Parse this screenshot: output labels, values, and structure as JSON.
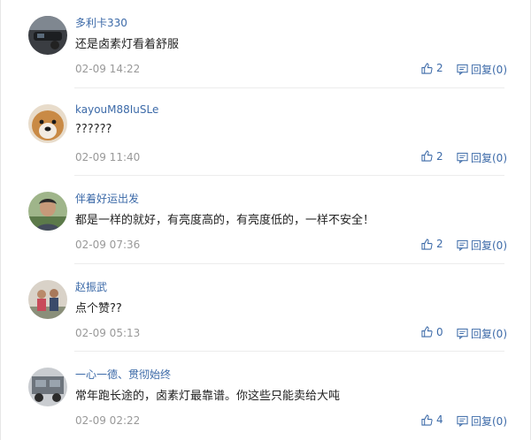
{
  "comments": [
    {
      "user": "多利卡330",
      "text": "还是卤素灯看着舒服",
      "time": "02-09 14:22",
      "likes": "2",
      "reply": "回复(0)",
      "avatar": "car-interior-avatar"
    },
    {
      "user": "kayouM88IuSLe",
      "text": "??????",
      "time": "02-09 11:40",
      "likes": "2",
      "reply": "回复(0)",
      "avatar": "dog-avatar"
    },
    {
      "user": "伴着好运出发",
      "text": "都是一样的就好，有亮度高的，有亮度低的，一样不安全！",
      "time": "02-09 07:36",
      "likes": "2",
      "reply": "回复(0)",
      "avatar": "person-avatar"
    },
    {
      "user": "赵振武",
      "text": "点个赞??",
      "time": "02-09 05:13",
      "likes": "0",
      "reply": "回复(0)",
      "avatar": "group-photo-avatar"
    },
    {
      "user": "一心一德、贯彻始终",
      "text": "常年跑长途的，卤素灯最靠谱。你这些只能卖给大吨",
      "time": "02-09 02:22",
      "likes": "4",
      "reply": "回复(0)",
      "avatar": "truck-avatar"
    }
  ],
  "colors": {
    "link": "#3c6aa8",
    "meta": "#999999",
    "text": "#222222",
    "divider": "#ececec"
  },
  "icons": {
    "like": "thumbs-up-icon",
    "reply": "reply-comment-icon"
  }
}
